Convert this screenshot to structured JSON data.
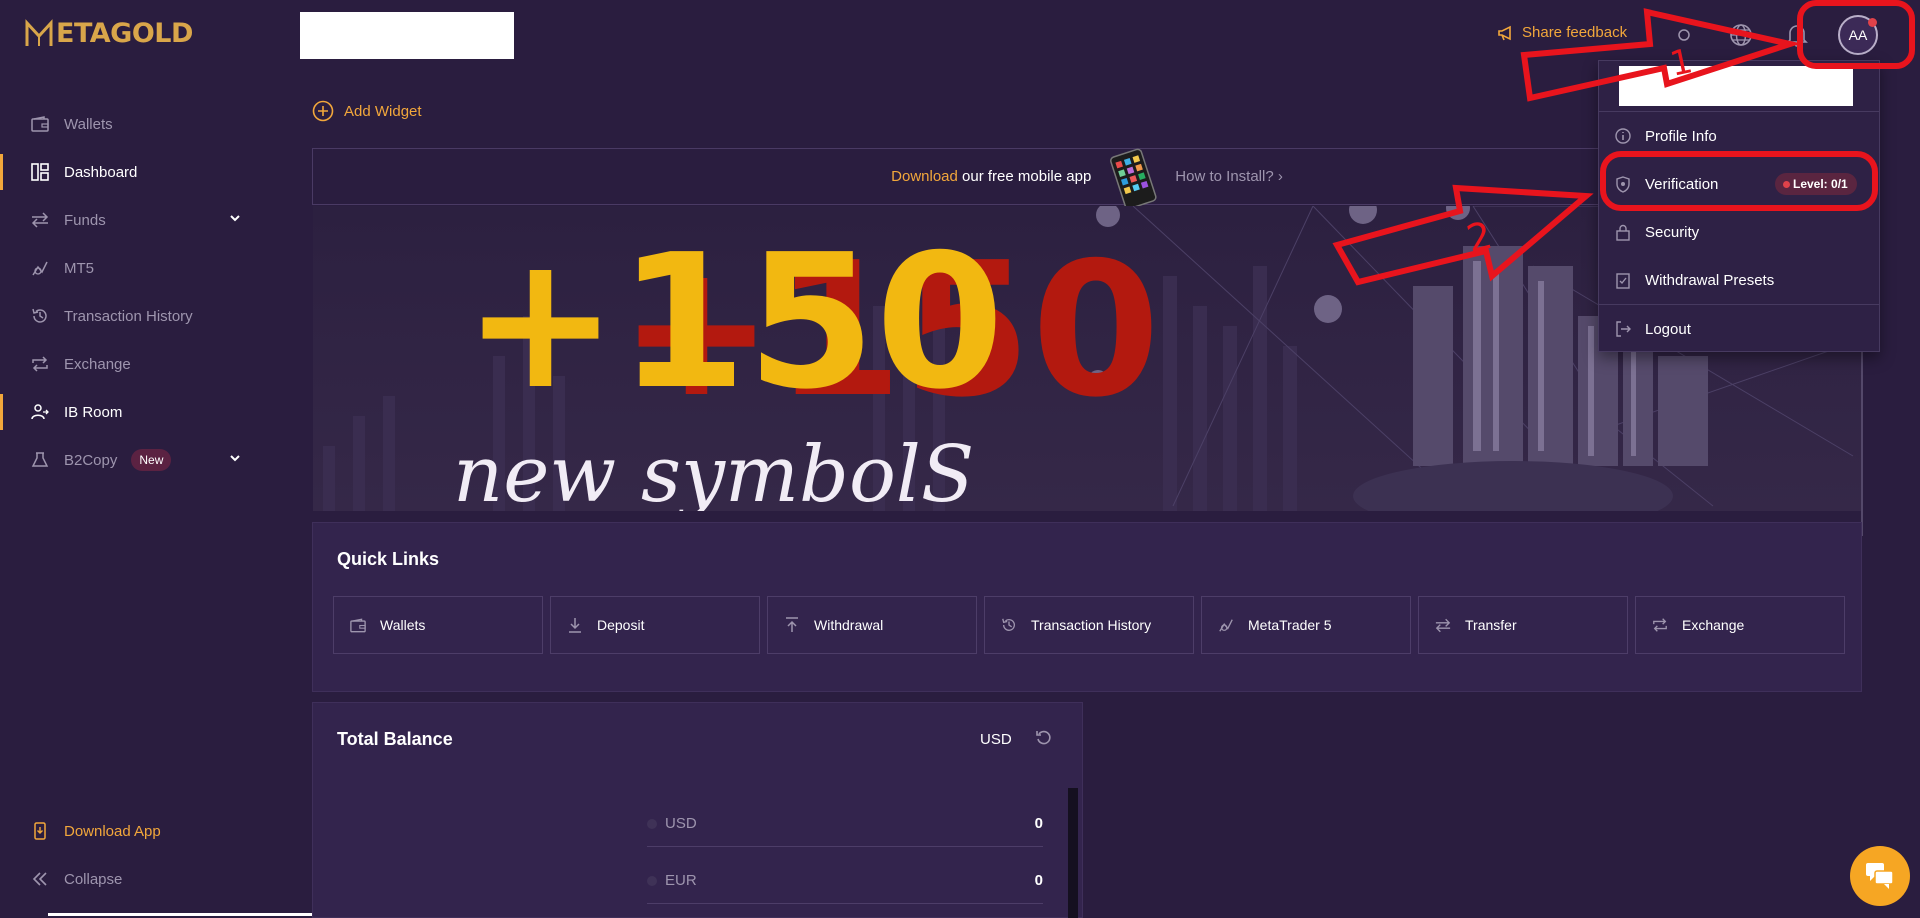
{
  "brand": {
    "logo_text": "ETAGOLD",
    "accent": "#f2a73b"
  },
  "sidebar": {
    "items": [
      {
        "label": "Wallets",
        "icon": "wallet-icon"
      },
      {
        "label": "Dashboard",
        "icon": "dashboard-icon",
        "active": true
      },
      {
        "label": "Funds",
        "icon": "transfer-icon",
        "expandable": true
      },
      {
        "label": "MT5",
        "icon": "mt5-icon"
      },
      {
        "label": "Transaction History",
        "icon": "history-icon"
      },
      {
        "label": "Exchange",
        "icon": "exchange-icon"
      },
      {
        "label": "IB Room",
        "icon": "ib-room-icon",
        "active": true
      },
      {
        "label": "B2Copy",
        "icon": "b2copy-icon",
        "badge": "New",
        "expandable": true
      }
    ],
    "download_app": "Download App",
    "collapse": "Collapse"
  },
  "header": {
    "share_feedback": "Share feedback",
    "avatar_initials": "AA"
  },
  "main": {
    "add_widget": "Add Widget",
    "download_bar": {
      "highlight": "Download",
      "text": " our free mobile app",
      "how_to": "How to Install? ›"
    },
    "banner": {
      "headline": "+150",
      "subline": "new symbolS"
    },
    "quick_links": {
      "title": "Quick Links",
      "items": [
        {
          "label": "Wallets",
          "icon": "wallet-icon"
        },
        {
          "label": "Deposit",
          "icon": "download-icon"
        },
        {
          "label": "Withdrawal",
          "icon": "upload-icon"
        },
        {
          "label": "Transaction History",
          "icon": "history-icon"
        },
        {
          "label": "MetaTrader 5",
          "icon": "mt5-icon"
        },
        {
          "label": "Transfer",
          "icon": "transfer-icon"
        },
        {
          "label": "Exchange",
          "icon": "exchange-icon"
        }
      ]
    },
    "total_balance": {
      "title": "Total Balance",
      "currency": "USD",
      "rows": [
        {
          "currency": "USD",
          "value": "0"
        },
        {
          "currency": "EUR",
          "value": "0"
        }
      ]
    }
  },
  "profile_menu": {
    "items": [
      {
        "label": "Profile Info",
        "icon": "info-icon"
      },
      {
        "label": "Verification",
        "icon": "shield-icon",
        "badge": "Level: 0/1"
      },
      {
        "label": "Security",
        "icon": "lock-icon"
      },
      {
        "label": "Withdrawal Presets",
        "icon": "checklist-icon"
      },
      {
        "label": "Logout",
        "icon": "logout-icon"
      }
    ]
  },
  "annotations": {
    "step1": "1",
    "step2": "2",
    "color": "#e8141d"
  }
}
